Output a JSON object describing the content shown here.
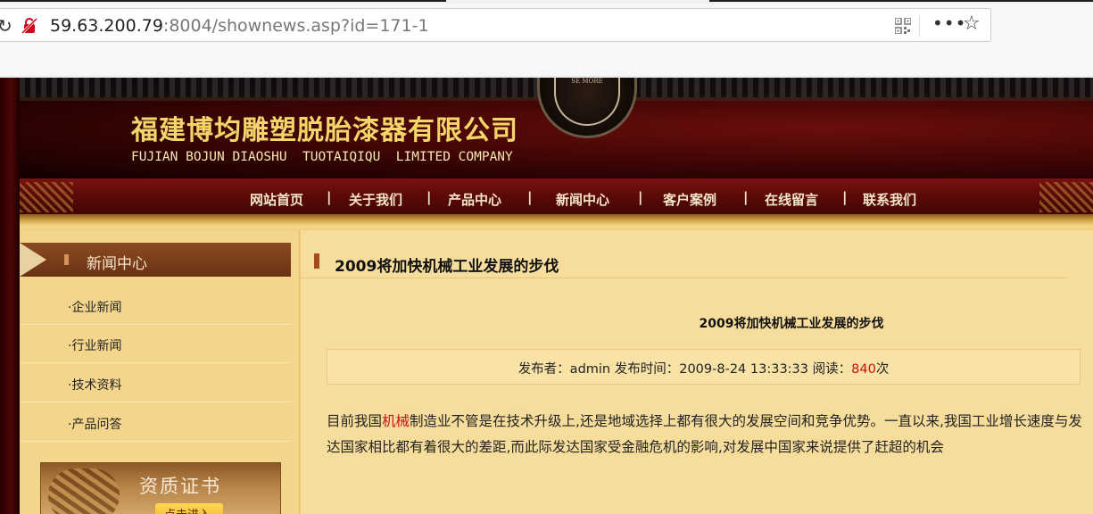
{
  "browser": {
    "url_host": "59.63.200.79",
    "url_rest": ":8004/shownews.asp?id=171-1",
    "more_label": "•••",
    "star_label": "☆",
    "reload_label": "↻"
  },
  "header": {
    "company_cn": "福建博均雕塑脱胎漆器有限公司",
    "company_en": "FUJIAN BOJUN DIAOSHU  TUOTAIQIQU  LIMITED COMPANY",
    "medal_text": "SE\nMORE"
  },
  "nav": {
    "items": [
      "网站首页",
      "关于我们",
      "产品中心",
      "新闻中心",
      "客户案例",
      "在线留言",
      "联系我们"
    ],
    "separator": "|"
  },
  "sidebar": {
    "title": "新闻中心",
    "items": [
      "·企业新闻",
      "·行业新闻",
      "·技术资料",
      "·产品问答"
    ],
    "cert_title": "资质证书",
    "cert_button": "点击进入"
  },
  "article": {
    "section_title": "2009将加快机械工业发展的步伐",
    "title": "2009将加快机械工业发展的步伐",
    "meta_prefix": "发布者：admin 发布时间：2009-8-24 13:33:33 阅读：",
    "meta_reads": "840",
    "meta_suffix": "次",
    "body_before": "目前我国",
    "body_keyword": "机械",
    "body_after": "制造业不管是在技术升级上,还是地域选择上都有很大的发展空间和竞争优势。一直以来,我国工业增长速度与发达国家相比都有着很大的差距,而此际发达国家受金融危机的影响,对发展中国家来说提供了赶超的机会"
  },
  "colors": {
    "header_dark": "#3a0404",
    "gold_text": "#f3d56a",
    "page_bg": "#f2cb7d",
    "highlight": "#d01010"
  }
}
